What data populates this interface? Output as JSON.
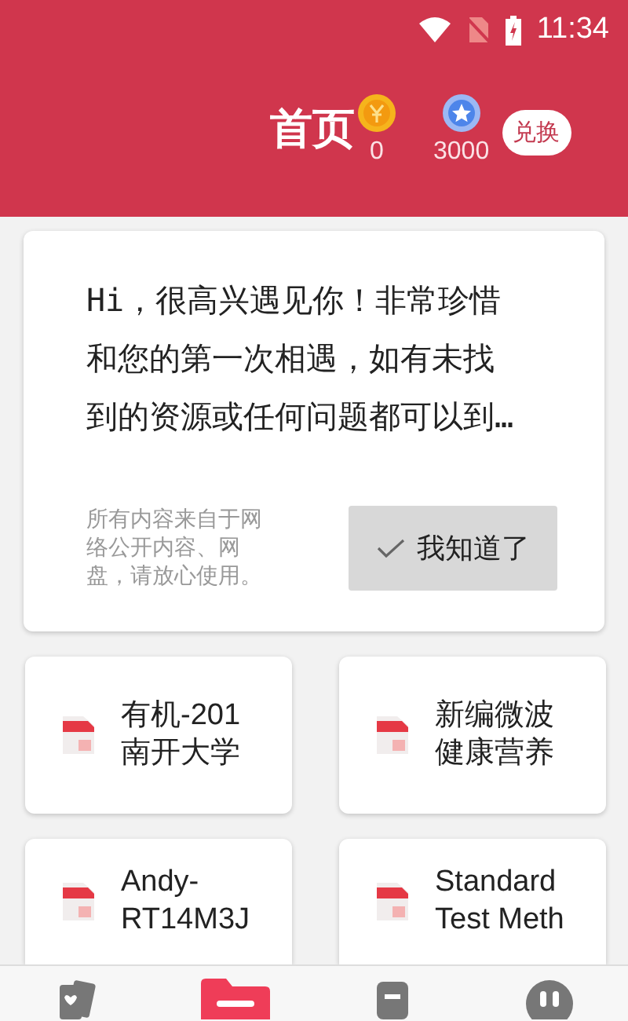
{
  "status_bar": {
    "time": "11:34"
  },
  "header": {
    "title": "首页",
    "coins": [
      {
        "kind": "gold",
        "amount": "0"
      },
      {
        "kind": "star",
        "amount": "3000"
      }
    ],
    "exchange_button": "兑换"
  },
  "notice": {
    "text": "Hi，很高兴遇见你！非常珍惜和您的第一次相遇，如有未找到的资源或任何问题都可以到…",
    "note": "所有内容来自于网络公开内容、网盘，请放心使用。",
    "button": "我知道了"
  },
  "files": [
    {
      "title": "有机-201\n南开大学"
    },
    {
      "title": "新编微波健康营养"
    },
    {
      "title": "Andy-\nRT14M3J"
    },
    {
      "title": "Standard\nTest Meth"
    }
  ],
  "bottom_nav": [
    {
      "selected": false
    },
    {
      "selected": true
    },
    {
      "selected": false
    },
    {
      "selected": false
    }
  ]
}
